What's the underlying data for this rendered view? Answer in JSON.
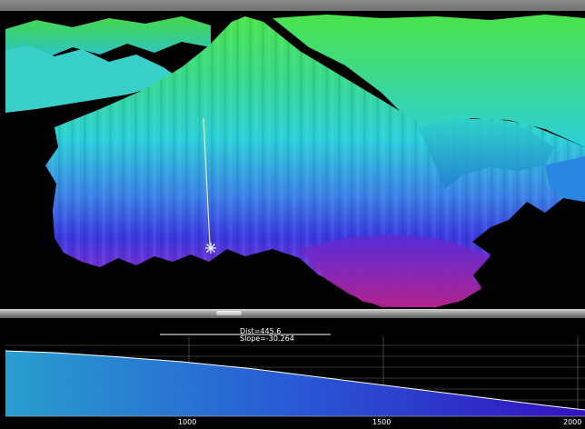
{
  "profile": {
    "dist_label": "Dist=445.6",
    "slope_label": "Slope=-30.264",
    "x_ticks": [
      "1000",
      "1500",
      "2000"
    ]
  },
  "colors": {
    "terrain_high": "#4be34b",
    "terrain_mid": "#2bcfd9",
    "terrain_low": "#3a37e0",
    "terrain_valley": "#c0207c",
    "profile_fill_left": "#2aa6d9",
    "profile_fill_right": "#3512c9",
    "marker_line": "#e8e8b0"
  },
  "icons": {
    "marker": "asterisk-marker-icon"
  }
}
